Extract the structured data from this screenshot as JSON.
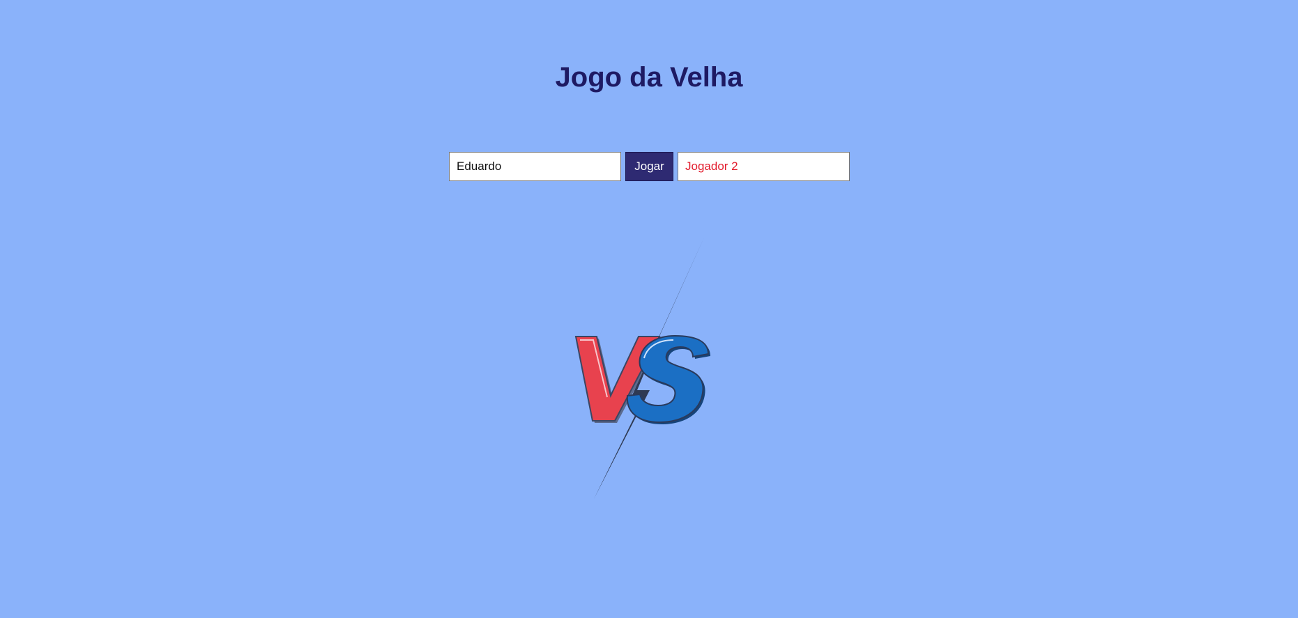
{
  "page": {
    "title": "Jogo da Velha"
  },
  "form": {
    "player1_value": "Eduardo",
    "play_label": "Jogar",
    "player2_value": "Jogador 2"
  },
  "logo": {
    "text": "VS",
    "icon": "versus-icon",
    "colors": {
      "v": "#e8424e",
      "s": "#1b6fc4",
      "bolt": "#2f3a53"
    }
  },
  "colors": {
    "background": "#8ab2fa",
    "title": "#1e1a63",
    "button": "#2e2a72",
    "player2_text": "#e21b2c"
  }
}
